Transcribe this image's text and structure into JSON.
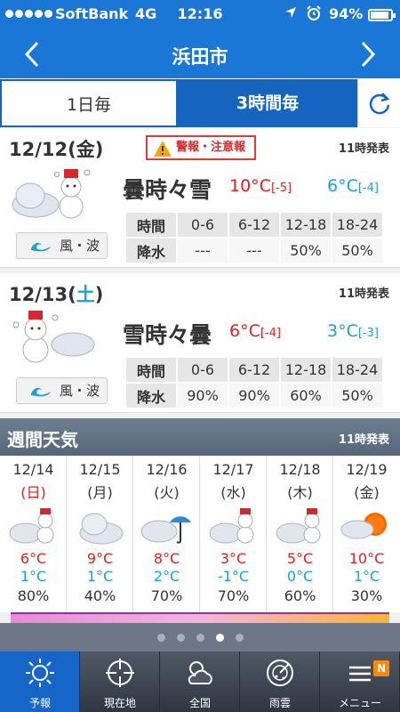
{
  "status": {
    "carrier": "SoftBank",
    "network": "4G",
    "time": "12:16",
    "battery": "94%"
  },
  "nav": {
    "title": "浜田市"
  },
  "tabs": {
    "daily": "1日毎",
    "three_hour": "3時間毎"
  },
  "day1": {
    "date": "12/12",
    "weekday": "金",
    "warning": "警報・注意報",
    "issued": "11時発表",
    "condition": "曇時々雪",
    "high": "10°C",
    "high_diff": "[-5]",
    "low": "6°C",
    "low_diff": "[-4]",
    "wind_label": "風・波",
    "headers": [
      "時間",
      "0-6",
      "6-12",
      "12-18",
      "18-24"
    ],
    "precip": [
      "降水",
      "---",
      "---",
      "50%",
      "50%"
    ]
  },
  "day2": {
    "date": "12/13",
    "weekday": "土",
    "issued": "11時発表",
    "condition": "雪時々曇",
    "high": "6°C",
    "high_diff": "[-4]",
    "low": "3°C",
    "low_diff": "[-3]",
    "wind_label": "風・波",
    "headers": [
      "時間",
      "0-6",
      "6-12",
      "12-18",
      "18-24"
    ],
    "precip": [
      "降水",
      "90%",
      "90%",
      "60%",
      "50%"
    ]
  },
  "weekly": {
    "title": "週間天気",
    "issued": "11時発表",
    "days": [
      {
        "date": "12/14",
        "weekday": "(日)",
        "high": "6°C",
        "low": "1°C",
        "pop": "80%",
        "icon": "cloud-snow-icon"
      },
      {
        "date": "12/15",
        "weekday": "(月)",
        "high": "9°C",
        "low": "1°C",
        "pop": "40%",
        "icon": "cloud-icon"
      },
      {
        "date": "12/16",
        "weekday": "(火)",
        "high": "8°C",
        "low": "2°C",
        "pop": "70%",
        "icon": "cloud-umbrella-icon"
      },
      {
        "date": "12/17",
        "weekday": "(水)",
        "high": "3°C",
        "low": "-1°C",
        "pop": "70%",
        "icon": "cloud-snow-icon"
      },
      {
        "date": "12/18",
        "weekday": "(木)",
        "high": "5°C",
        "low": "0°C",
        "pop": "60%",
        "icon": "cloud-snow-icon"
      },
      {
        "date": "12/19",
        "weekday": "(金)",
        "high": "10°C",
        "low": "1°C",
        "pop": "30%",
        "icon": "cloud-sun-icon"
      }
    ]
  },
  "page_dots": {
    "count": 5,
    "active": 3
  },
  "tabbar": {
    "forecast": "予報",
    "current": "現在地",
    "national": "全国",
    "radar": "雨雲",
    "menu": "メニュー",
    "badge": "N"
  }
}
